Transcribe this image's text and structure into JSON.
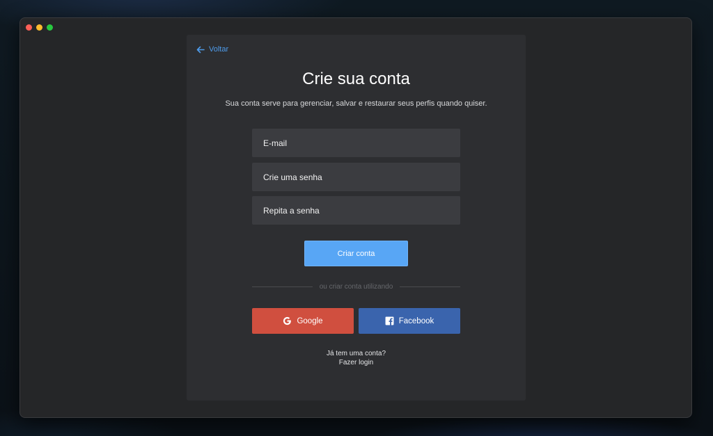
{
  "window": {
    "controls": [
      "close",
      "minimize",
      "maximize"
    ]
  },
  "header": {
    "back_label": "Voltar",
    "back_icon": "arrow-left-icon"
  },
  "main": {
    "title": "Crie sua conta",
    "subtitle": "Sua conta serve para gerenciar, salvar e restaurar seus perfis quando quiser."
  },
  "form": {
    "email": {
      "placeholder": "E-mail",
      "value": ""
    },
    "password": {
      "placeholder": "Crie uma senha",
      "value": ""
    },
    "repeat_password": {
      "placeholder": "Repita a senha",
      "value": ""
    },
    "submit_label": "Criar conta"
  },
  "divider_text": "ou criar conta utilizando",
  "social": {
    "google": {
      "label": "Google",
      "icon": "google-icon"
    },
    "facebook": {
      "label": "Facebook",
      "icon": "facebook-icon"
    }
  },
  "footer": {
    "question": "Já tem uma conta?",
    "login_link": "Fazer login"
  },
  "colors": {
    "accent": "#58a6f5",
    "link": "#4e9bea",
    "google": "#d04f3f",
    "facebook": "#3a64ad",
    "card": "#2d2e31",
    "window": "#252628",
    "field": "#3b3c40"
  }
}
